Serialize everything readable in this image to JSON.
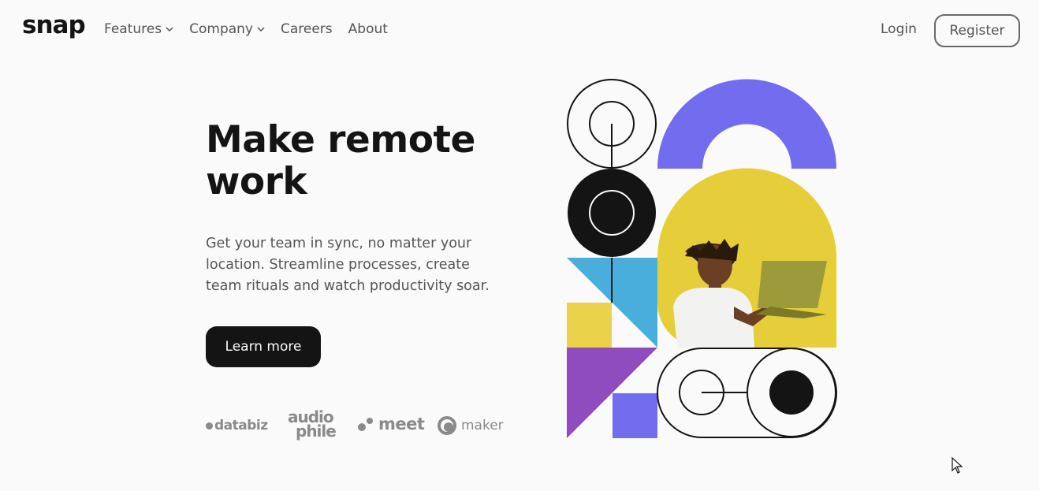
{
  "header": {
    "logo": "snap",
    "nav": [
      {
        "label": "Features",
        "has_dropdown": true
      },
      {
        "label": "Company",
        "has_dropdown": true
      },
      {
        "label": "Careers",
        "has_dropdown": false
      },
      {
        "label": "About",
        "has_dropdown": false
      }
    ],
    "login_label": "Login",
    "register_label": "Register"
  },
  "hero": {
    "title": "Make remote work",
    "text": "Get your team in sync, no matter your location. Streamline processes, create team rituals and watch productivity soar.",
    "cta_label": "Learn more"
  },
  "clients": {
    "databiz": "databiz",
    "audiophile_top": "audio",
    "audiophile_bottom": "phile",
    "meet": "meet",
    "maker": "maker"
  },
  "illustration": {
    "icon": "remote-worker-illustration",
    "colors": {
      "purple": "#726cee",
      "blue": "#4aaedd",
      "yellow": "#ebd24b",
      "violet": "#8e4cbe",
      "photo_bg": "#e6ce3a",
      "black": "#141414"
    }
  }
}
